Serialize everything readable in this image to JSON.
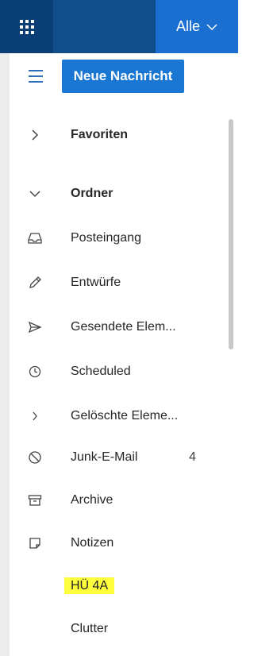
{
  "topbar": {
    "scope_label": "Alle"
  },
  "toolbar": {
    "new_message_label": "Neue Nachricht"
  },
  "sections": {
    "favorites_label": "Favoriten",
    "folders_label": "Ordner"
  },
  "folders": [
    {
      "label": "Posteingang",
      "icon": "inbox-icon"
    },
    {
      "label": "Entwürfe",
      "icon": "pencil-icon"
    },
    {
      "label": "Gesendete Elem...",
      "icon": "send-icon"
    },
    {
      "label": "Scheduled",
      "icon": "clock-icon"
    },
    {
      "label": "Gelöschte Eleme...",
      "icon": "chevron-right-icon"
    },
    {
      "label": "Junk-E-Mail",
      "icon": "blocked-icon",
      "count": "4"
    },
    {
      "label": "Archive",
      "icon": "archive-icon"
    },
    {
      "label": "Notizen",
      "icon": "note-icon"
    },
    {
      "label": "HÜ 4A",
      "highlighted": true
    },
    {
      "label": "Clutter"
    }
  ],
  "colors": {
    "topbar": "#0f4d8c",
    "accent": "#1976d2",
    "highlight": "#ffff3d"
  }
}
